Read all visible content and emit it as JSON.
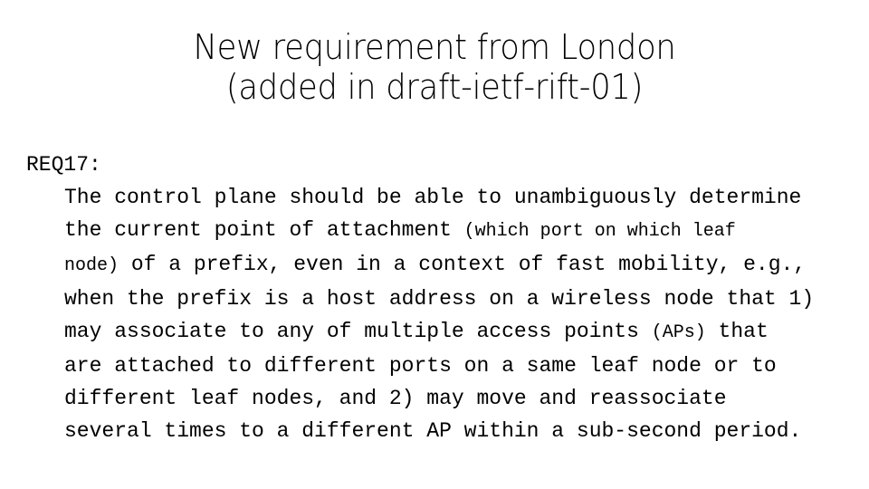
{
  "slide": {
    "background_color": "#ffffff",
    "text_color": "#000000",
    "title": {
      "line1": "New requirement from London",
      "line2": "(added in draft-ietf-rift-01)"
    },
    "body": {
      "req_label": "REQ17:",
      "lines": [
        {
          "segments": [
            {
              "text": "The control plane should be able to unambiguously determine",
              "size": "normal"
            }
          ]
        },
        {
          "segments": [
            {
              "text": "the current point of attachment ",
              "size": "normal"
            },
            {
              "text": "(which port on which leaf",
              "size": "small"
            }
          ]
        },
        {
          "segments": [
            {
              "text": "node)",
              "size": "small"
            },
            {
              "text": " of a prefix, even in a context of fast mobility, e.g.,",
              "size": "normal"
            }
          ]
        },
        {
          "segments": [
            {
              "text": "when the prefix is a host address on a wireless node that 1)",
              "size": "normal"
            }
          ]
        },
        {
          "segments": [
            {
              "text": "may associate to any of multiple access points ",
              "size": "normal"
            },
            {
              "text": "(APs)",
              "size": "small"
            },
            {
              "text": " that",
              "size": "normal"
            }
          ]
        },
        {
          "segments": [
            {
              "text": "are attached to different ports on a same leaf node or to",
              "size": "normal"
            }
          ]
        },
        {
          "segments": [
            {
              "text": "different leaf nodes, and 2) may move and reassociate",
              "size": "normal"
            }
          ]
        },
        {
          "segments": [
            {
              "text": "several times to a different AP within a sub-second period.",
              "size": "normal"
            }
          ]
        }
      ],
      "full_text": "REQ17: The control plane should be able to unambiguously determine the current point of attachment (which port on which leaf node) of a prefix, even in a context of fast mobility, e.g., when the prefix is a host address on a wireless node that 1) may associate to any of multiple access points (APs) that are attached to different ports on a same leaf node or to different leaf nodes, and 2) may move and reassociate several times to a different AP within a sub-second period."
    }
  }
}
